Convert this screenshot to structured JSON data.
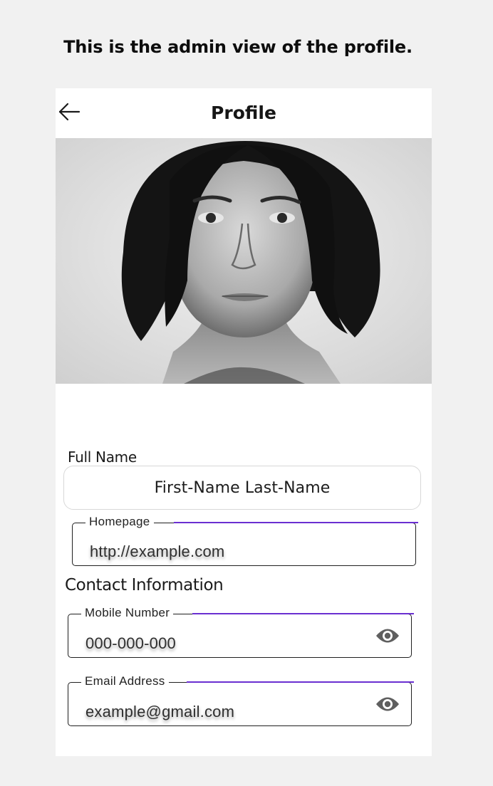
{
  "caption": "This is the admin view of the profile.",
  "header": {
    "title": "Profile",
    "back_icon": "arrow-left-icon"
  },
  "photo": {
    "description_icon": "profile-photo"
  },
  "full_name": {
    "label": "Full Name",
    "value": "First-Name Last-Name"
  },
  "homepage": {
    "label": "Homepage",
    "value": "http://example.com"
  },
  "contact": {
    "heading": "Contact Information",
    "mobile": {
      "label": "Mobile Number",
      "value": "000-000-000",
      "toggle_icon": "eye-icon"
    },
    "email": {
      "label": "Email Address",
      "value": "example@gmail.com",
      "toggle_icon": "eye-icon"
    }
  },
  "colors": {
    "accent": "#6a2fd1",
    "background": "#f1f1f1",
    "card": "#ffffff",
    "icon_gray": "#5f5f5f"
  }
}
